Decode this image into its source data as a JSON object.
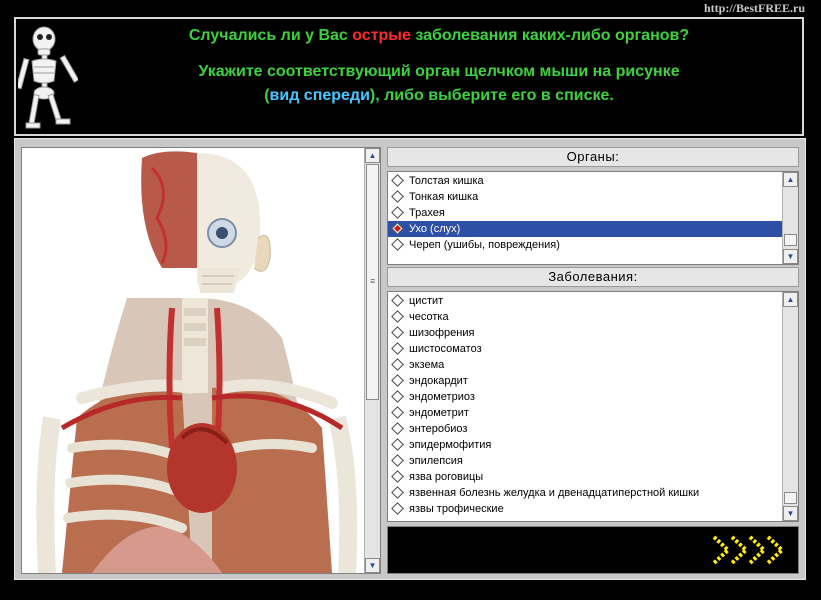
{
  "watermark": "http://BestFREE.ru",
  "header": {
    "question_part1": "Случались ли у Вас ",
    "question_highlight": "острые",
    "question_part2": " заболевания каких-либо органов?",
    "instruction_line1": "Укажите соответствующий орган щелчком мыши на рисунке",
    "instruction_line2_prefix": "(",
    "instruction_view": "вид спереди",
    "instruction_line2_suffix": "), либо выберите его в списке."
  },
  "organs_panel": {
    "title": "Органы:",
    "items": [
      {
        "label": "Толстая кишка",
        "selected": false
      },
      {
        "label": "Тонкая кишка",
        "selected": false
      },
      {
        "label": "Трахея",
        "selected": false
      },
      {
        "label": "Ухо (слух)",
        "selected": true
      },
      {
        "label": "Череп (ушибы, повреждения)",
        "selected": false
      }
    ]
  },
  "diseases_panel": {
    "title": "Заболевания:",
    "items": [
      "цистит",
      "чесотка",
      "шизофрения",
      "шистосоматоз",
      "экзема",
      "эндокардит",
      "эндометриоз",
      "эндометрит",
      "энтеробиоз",
      "эпидермофития",
      "эпилепсия",
      "язва роговицы",
      "язвенная болезнь желудка и двенадцатиперстной кишки",
      "язвы трофические"
    ]
  },
  "icons": {
    "logo": "skeleton-icon",
    "next": "next-arrows-icon",
    "scroll_up": "arrow-up-icon",
    "scroll_down": "arrow-down-icon"
  },
  "colors": {
    "question": "#3cd23c",
    "highlight_red": "#ff2a2a",
    "highlight_cyan": "#46c8ff",
    "selection": "#2e4fa6",
    "next_arrows": "#ffee00"
  }
}
